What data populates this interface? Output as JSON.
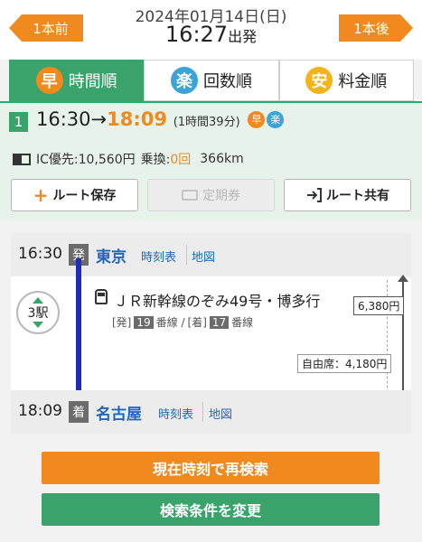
{
  "header": {
    "prev_label": "1本前",
    "next_label": "1本後",
    "date": "2024年01月14日(日)",
    "time": "16:27",
    "time_suffix": "出発"
  },
  "sort_tabs": [
    {
      "icon_char": "早",
      "label": "時間順",
      "active": true
    },
    {
      "icon_char": "楽",
      "label": "回数順",
      "active": false
    },
    {
      "icon_char": "安",
      "label": "料金順",
      "active": false
    }
  ],
  "summary": {
    "route_number": "1",
    "depart": "16:30",
    "arrow": "→",
    "arrive": "18:09",
    "duration": "(1時間39分)",
    "badge_haya": "早",
    "badge_raku": "楽",
    "ic_label": "IC優先:10,560円",
    "transfer_label": "乗換:",
    "transfer_count": "0回",
    "distance": "366km",
    "save_label": "ルート保存",
    "teiki_label": "定期券",
    "share_label": "ルート共有"
  },
  "route": {
    "from": {
      "time": "16:30",
      "badge": "発",
      "station": "東京",
      "timetable": "時刻表",
      "map": "地図"
    },
    "to": {
      "time": "18:09",
      "badge": "着",
      "station": "名古屋",
      "timetable": "時刻表",
      "map": "地図"
    },
    "station_count": "3駅",
    "train_name": "ＪＲ新幹線のぞみ49号・博多行",
    "dep_track_prefix": "[発]",
    "dep_track": "19",
    "track_suffix_1": "番線 /",
    "arr_track_prefix": "[着]",
    "arr_track": "17",
    "track_suffix_2": "番線",
    "fare": "6,380円",
    "jiyu_fare": "自由席：4,180円"
  },
  "buttons": {
    "research_now": "現在時刻で再検索",
    "change_conditions": "検索条件を変更"
  },
  "colors": {
    "accent_orange": "#f08a1e",
    "accent_green": "#3aa36b",
    "rail_blue": "#1e2cb8",
    "link_blue": "#2266b9"
  }
}
